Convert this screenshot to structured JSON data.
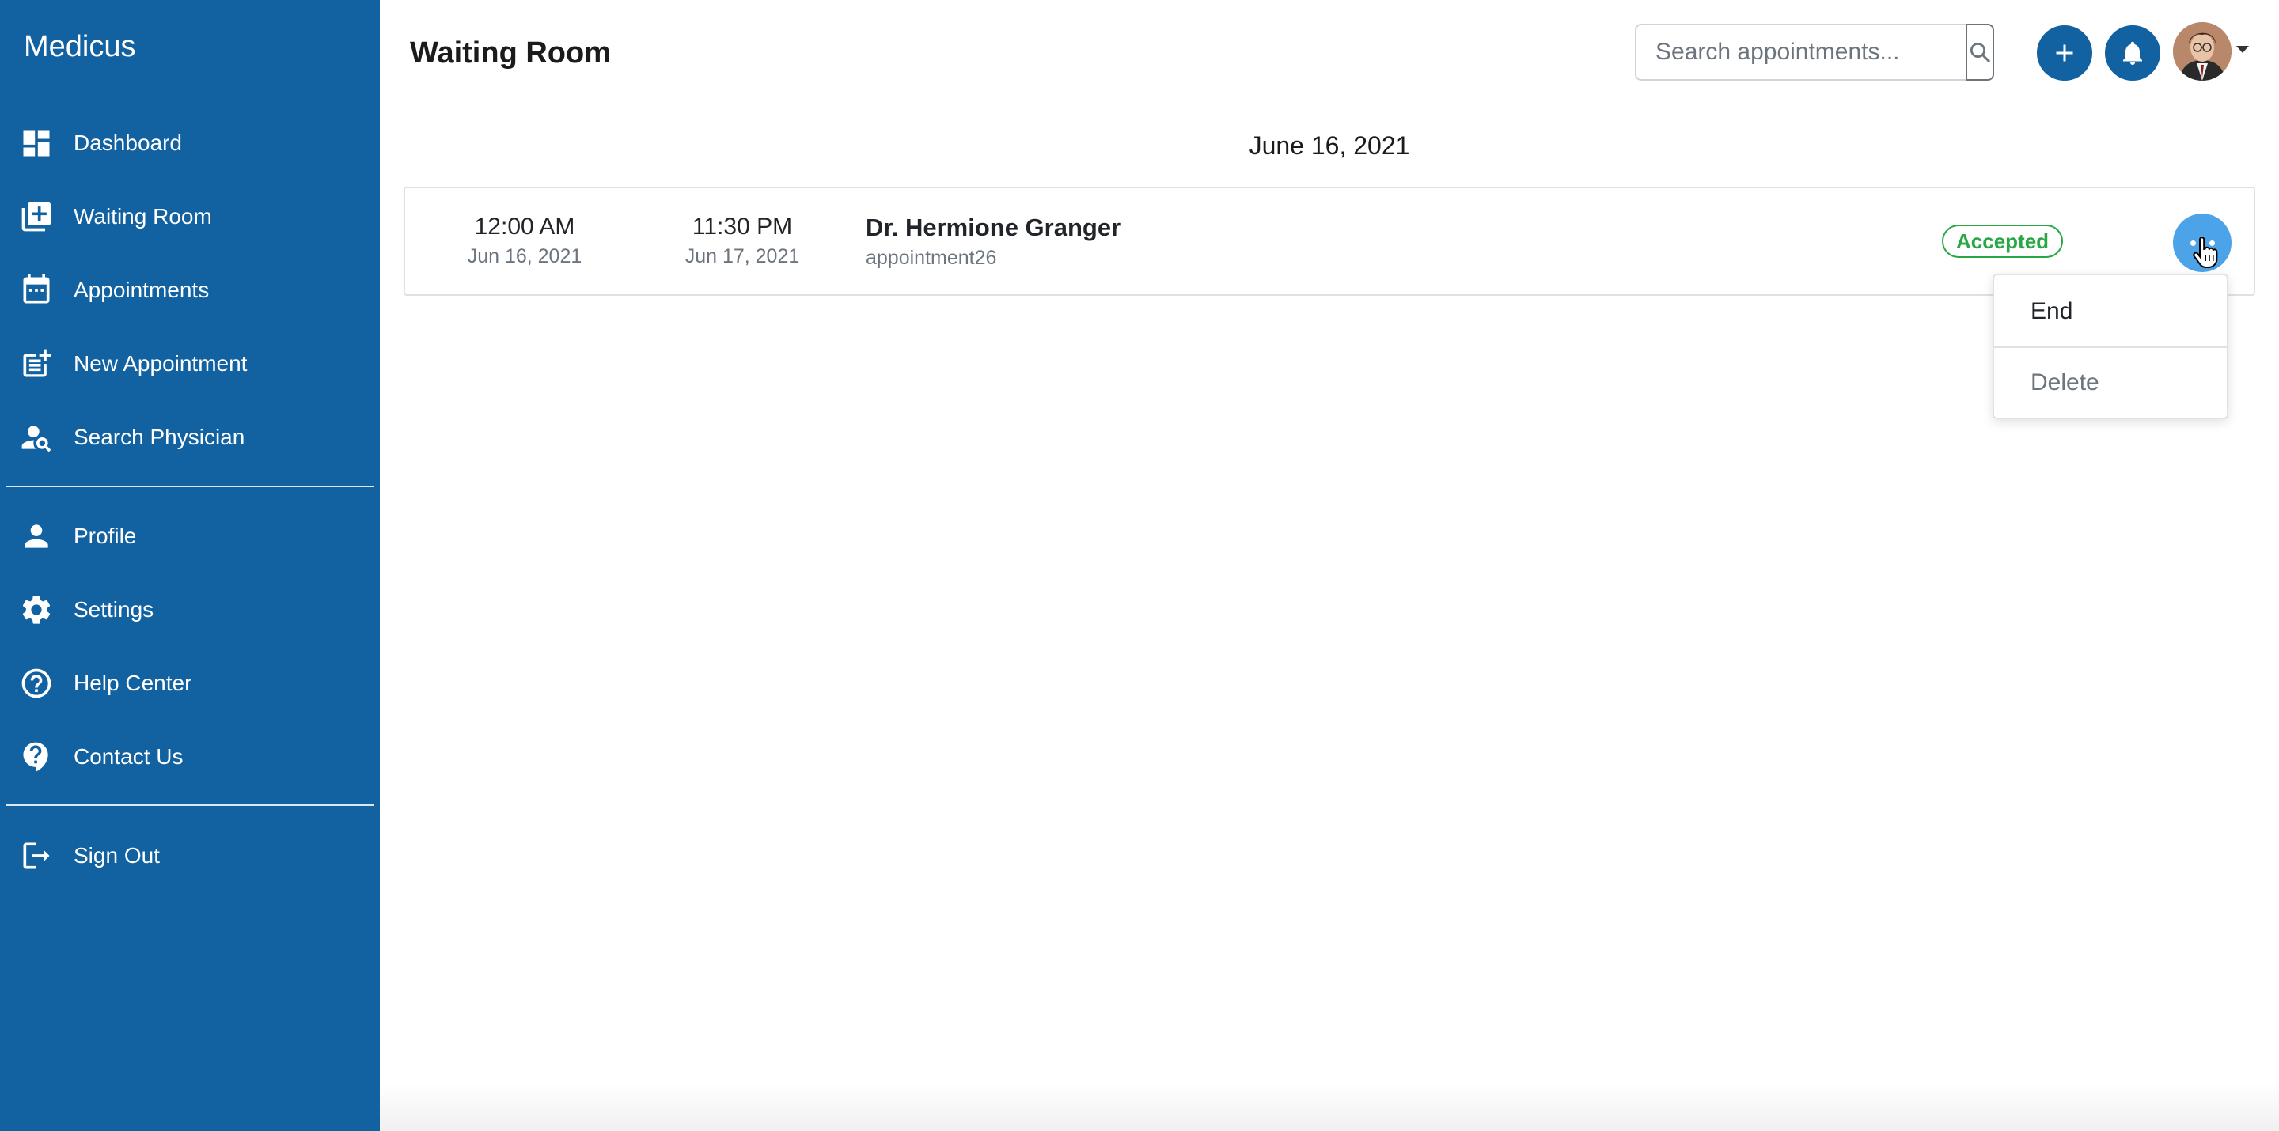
{
  "app": {
    "brand": "Medicus"
  },
  "sidebar": {
    "items": [
      {
        "label": "Dashboard",
        "icon": "dashboard-icon"
      },
      {
        "label": "Waiting Room",
        "icon": "add-box-icon"
      },
      {
        "label": "Appointments",
        "icon": "calendar-icon"
      },
      {
        "label": "New Appointment",
        "icon": "post-add-icon"
      },
      {
        "label": "Search Physician",
        "icon": "person-search-icon"
      },
      {
        "label": "Profile",
        "icon": "person-icon"
      },
      {
        "label": "Settings",
        "icon": "gear-icon"
      },
      {
        "label": "Help Center",
        "icon": "help-circle-icon"
      },
      {
        "label": "Contact Us",
        "icon": "help-bubble-icon"
      },
      {
        "label": "Sign Out",
        "icon": "sign-out-icon"
      }
    ]
  },
  "header": {
    "title": "Waiting Room",
    "search_placeholder": "Search appointments...",
    "icons": [
      "search-icon",
      "plus-icon",
      "bell-icon",
      "avatar",
      "caret-down-icon"
    ]
  },
  "content": {
    "date_heading": "June 16, 2021",
    "appointment": {
      "start_time": "12:00 AM",
      "start_date": "Jun 16, 2021",
      "end_time": "11:30 PM",
      "end_date": "Jun 17, 2021",
      "doctor": "Dr. Hermione Granger",
      "appointment_id": "appointment26",
      "status": "Accepted"
    },
    "menu": {
      "end_label": "End",
      "delete_label": "Delete"
    }
  },
  "colors": {
    "sidebar": "#1261a0",
    "accent": "#1261a0",
    "more_button": "#4da3e8",
    "status_accepted": "#28a745"
  }
}
